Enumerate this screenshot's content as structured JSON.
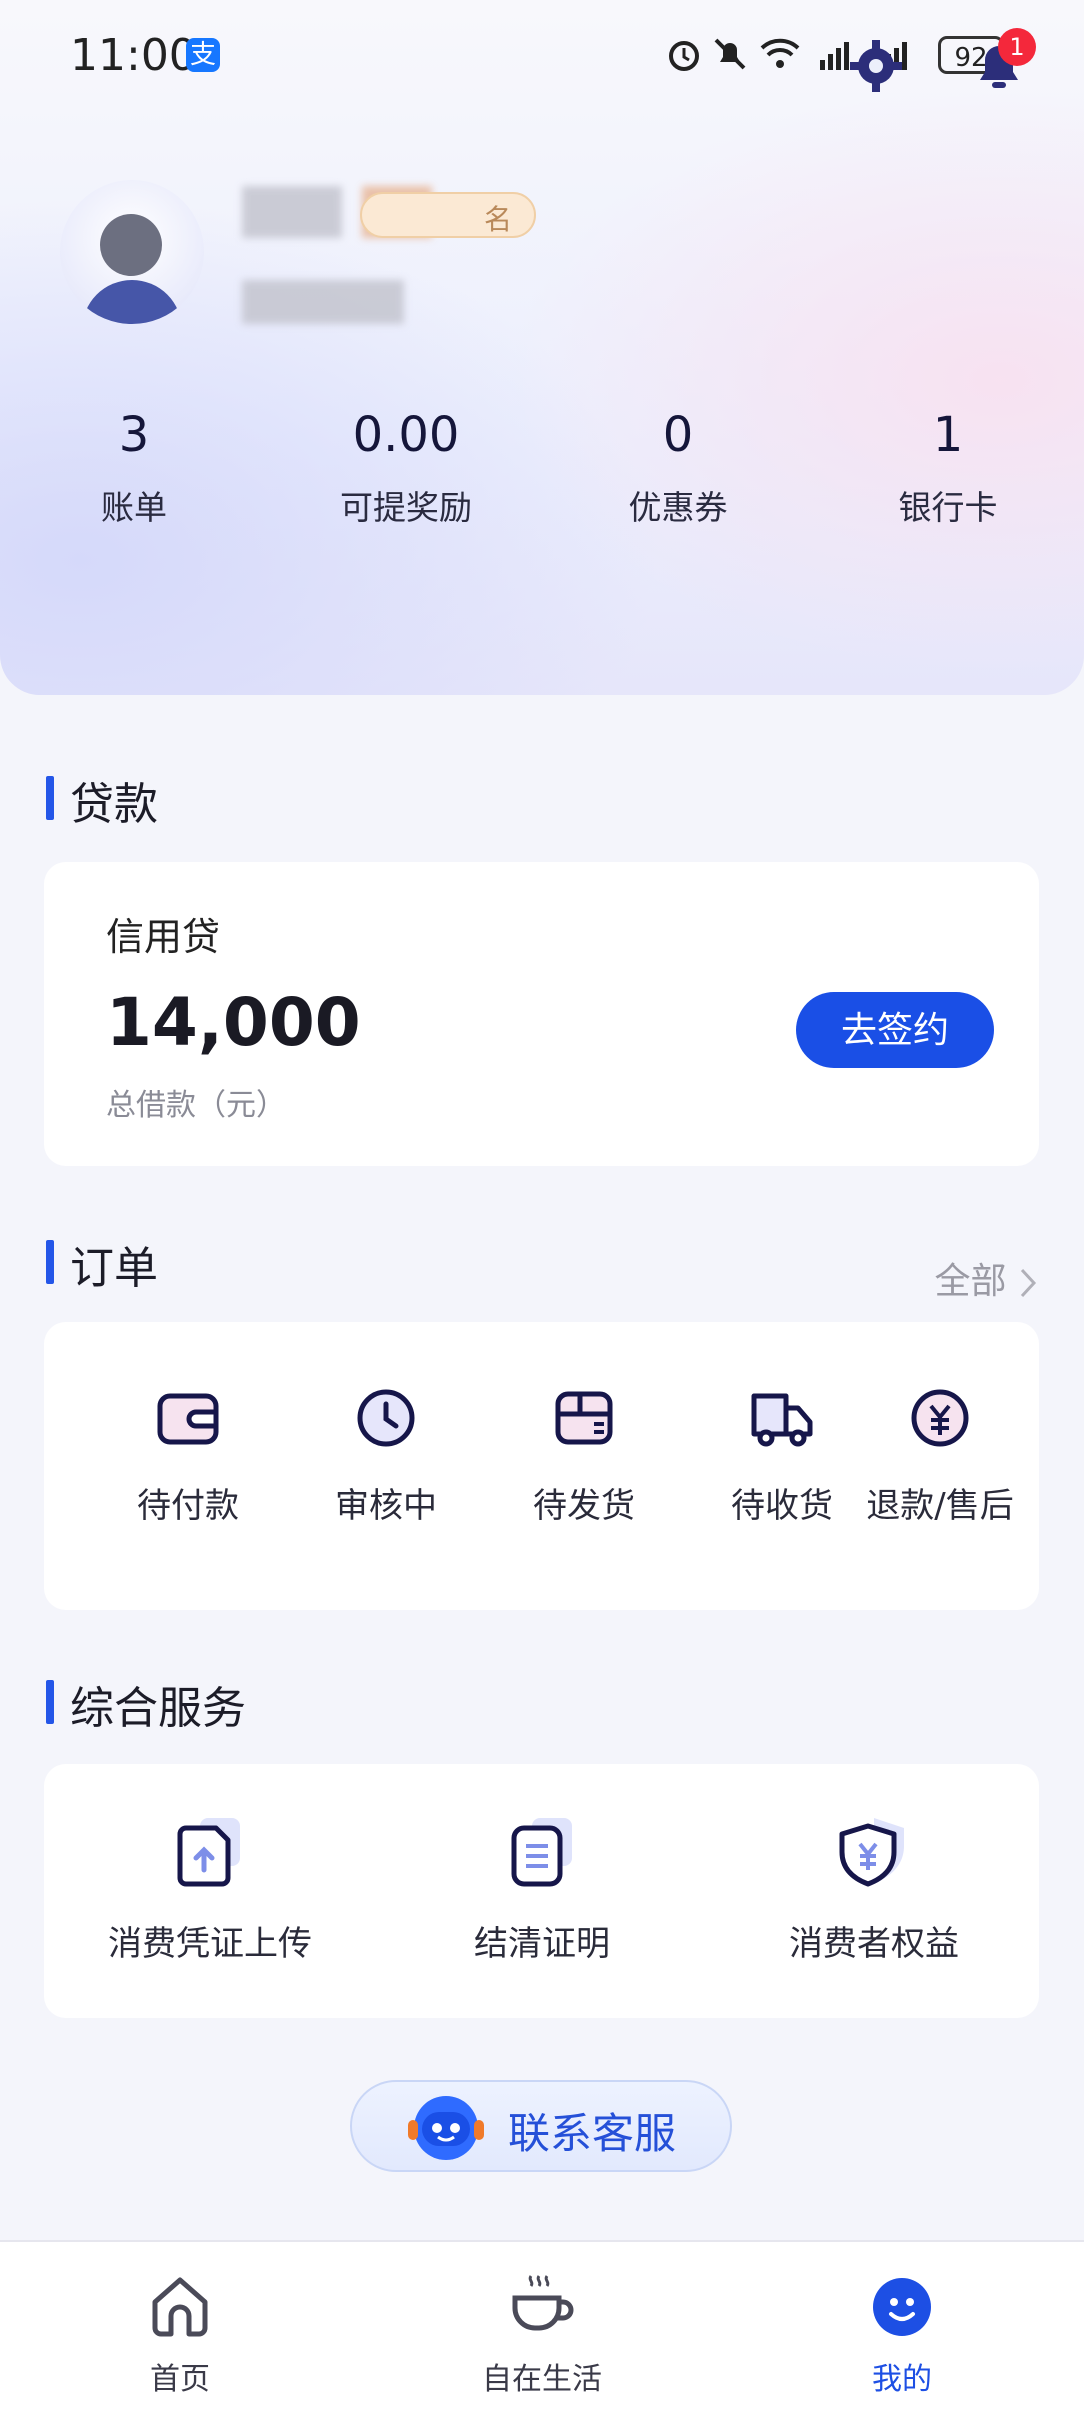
{
  "status_bar": {
    "time": "11:00",
    "battery": "92",
    "notification_count": "1"
  },
  "profile": {
    "name_badge": "名"
  },
  "stats": [
    {
      "value": "3",
      "label": "账单"
    },
    {
      "value": "0.00",
      "label": "可提奖励"
    },
    {
      "value": "0",
      "label": "优惠券"
    },
    {
      "value": "1",
      "label": "银行卡"
    }
  ],
  "loan": {
    "section_title": "贷款",
    "product_name": "信用贷",
    "amount": "14,000",
    "amount_label": "总借款（元）",
    "sign_button": "去签约"
  },
  "orders": {
    "section_title": "订单",
    "all_link": "全部",
    "items": [
      {
        "label": "待付款",
        "icon": "wallet-icon"
      },
      {
        "label": "审核中",
        "icon": "clock-icon"
      },
      {
        "label": "待发货",
        "icon": "package-icon"
      },
      {
        "label": "待收货",
        "icon": "truck-icon"
      },
      {
        "label": "退款/售后",
        "icon": "refund-icon"
      }
    ]
  },
  "services": {
    "section_title": "综合服务",
    "items": [
      {
        "label": "消费凭证上传",
        "icon": "upload-document-icon"
      },
      {
        "label": "结清证明",
        "icon": "certificate-icon"
      },
      {
        "label": "消费者权益",
        "icon": "shield-yuan-icon"
      }
    ]
  },
  "contact_service": {
    "label": "联系客服"
  },
  "tabbar": {
    "items": [
      {
        "label": "首页",
        "icon": "home-icon",
        "active": false
      },
      {
        "label": "自在生活",
        "icon": "coffee-cup-icon",
        "active": false
      },
      {
        "label": "我的",
        "icon": "smile-icon",
        "active": true
      }
    ]
  },
  "colors": {
    "accent": "#1a4fe6",
    "badge_red": "#f4283b",
    "background": "#f4f5fb"
  }
}
